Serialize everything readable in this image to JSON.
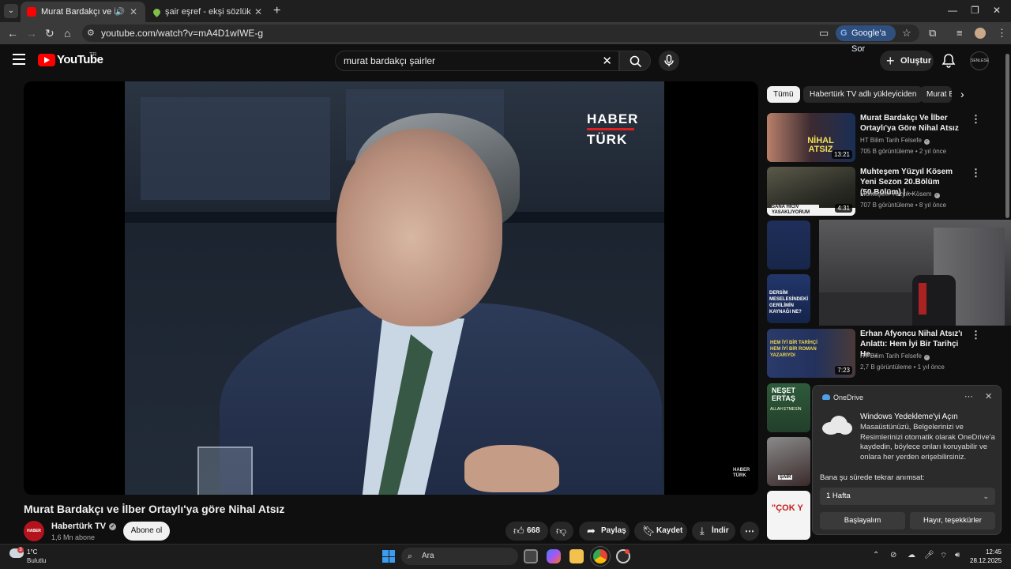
{
  "browser": {
    "tabs": [
      {
        "title": "Murat Bardakçı ve İlber Orta",
        "active": true
      },
      {
        "title": "şair eşref - ekşi sözlük",
        "active": false
      }
    ],
    "url": "youtube.com/watch?v=mA4D1wIWE-g",
    "google_ask_label": "Google'a Sor"
  },
  "youtube": {
    "logo_text": "YouTube",
    "region": "TR",
    "search_query": "murat bardakçı şairler",
    "create_label": "Oluştur",
    "avatar_text": "SENLESE"
  },
  "video": {
    "title": "Murat Bardakçı ve İlber Ortaylı'ya göre Nihal Atsız",
    "watermark_top": "HABER",
    "watermark_bottom": "TÜRK",
    "watermark_small": "HABER TÜRK",
    "channel": {
      "name": "Habertürk TV",
      "subscribers": "1,6 Mn abone",
      "avatar_text": "HABER TÜRK",
      "verified_mark": "✓"
    },
    "subscribe_label": "Abone ol",
    "like_count": "668",
    "share_label": "Paylaş",
    "save_label": "Kaydet",
    "download_label": "İndir"
  },
  "sidebar": {
    "chips": [
      "Tümü",
      "Habertürk TV adlı yükleyiciden",
      "Murat B"
    ],
    "recommendations": [
      {
        "title": "Murat Bardakçı Ve İlber Ortaylı'ya Göre Nihal Atsız",
        "channel": "HT Bilim Tarih Felsefe",
        "meta": "705 B görüntüleme • 2 yıl önce",
        "duration": "13:21",
        "thumb_text": "NİHAL ATSIZ"
      },
      {
        "title": "Muhteşem Yüzyıl Kösem Yeni Sezon 20.Bölüm (50.Bölüm) | ...",
        "channel": "Muhteşem Yüzyıl: Kösem",
        "meta": "707 B görüntüleme • 8 yıl önce",
        "duration": "4:31",
        "thumb_text": "SANA HİCİV YASAKLIYORUM"
      },
      {
        "title": "Erhan Afyoncu Nihal Atsız'ı Anlattı: Hem İyi Bir Tarihçi He...",
        "channel": "HT Bilim Tarih Felsefe",
        "meta": "2,7 B görüntüleme • 1 yıl önce",
        "duration": "7:23",
        "thumb_text": "HEM İYİ BİR TARİHÇİ HEM İYİ BİR ROMAN YAZARIYDI"
      }
    ],
    "partial_thumbs": [
      "DERSİM MESELESİNDEKİ GERİLİMİN KAYNAĞI NE?",
      "NEŞET ERTAŞ",
      "ALLAH ETMESİN",
      "ŞAİR",
      "\"ÇOK Y"
    ]
  },
  "toast": {
    "app": "OneDrive",
    "heading": "Windows Yedekleme'yi Açın",
    "body": "Masaüstünüzü, Belgelerinizi ve Resimlerinizi otomatik olarak OneDrive'a kaydedin, böylece onları koruyabilir ve onlara her yerden erişebilirsiniz.",
    "remind_label": "Bana şu sürede tekrar anımsat:",
    "remind_value": "1 Hafta",
    "primary_button": "Başlayalım",
    "secondary_button": "Hayır, teşekkürler"
  },
  "taskbar": {
    "temperature": "1°C",
    "condition": "Bulutlu",
    "weather_badge": "3",
    "search_label": "Ara",
    "time": "12:45",
    "date": "28.12.2025"
  },
  "colors": {
    "youtube_red": "#ff0000",
    "background": "#0f0f0f",
    "chip_selected": "#f1f1f1"
  }
}
